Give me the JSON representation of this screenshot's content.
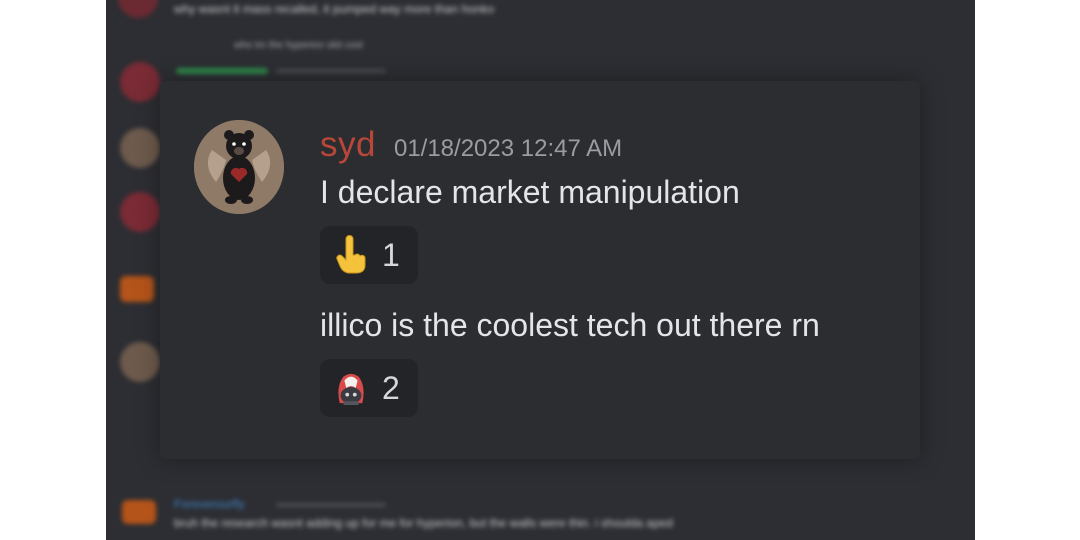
{
  "background": {
    "top_message": "why wasnt it mass recalled, it pumped way more than honko",
    "reply_line": "who tm the hyperion skit cost",
    "bottom_username": "Foreverourfly",
    "bottom_message": "bruh the research wasnt adding up for me for hyperion, but the walls were thin. i shoulda aped"
  },
  "message": {
    "username": "syd",
    "timestamp": "01/18/2023 12:47 AM",
    "lines": [
      {
        "text": "I declare market manipulation",
        "reaction": {
          "emoji_name": "pointing-up-hand-icon",
          "count": "1"
        }
      },
      {
        "text": "illico is the coolest tech out there rn",
        "reaction": {
          "emoji_name": "custom-character-emoji-icon",
          "count": "2"
        }
      }
    ]
  },
  "colors": {
    "username": "#b8473a",
    "timestamp": "#9a9ca2",
    "card_bg": "#2b2d31",
    "reaction_bg": "#232428"
  }
}
